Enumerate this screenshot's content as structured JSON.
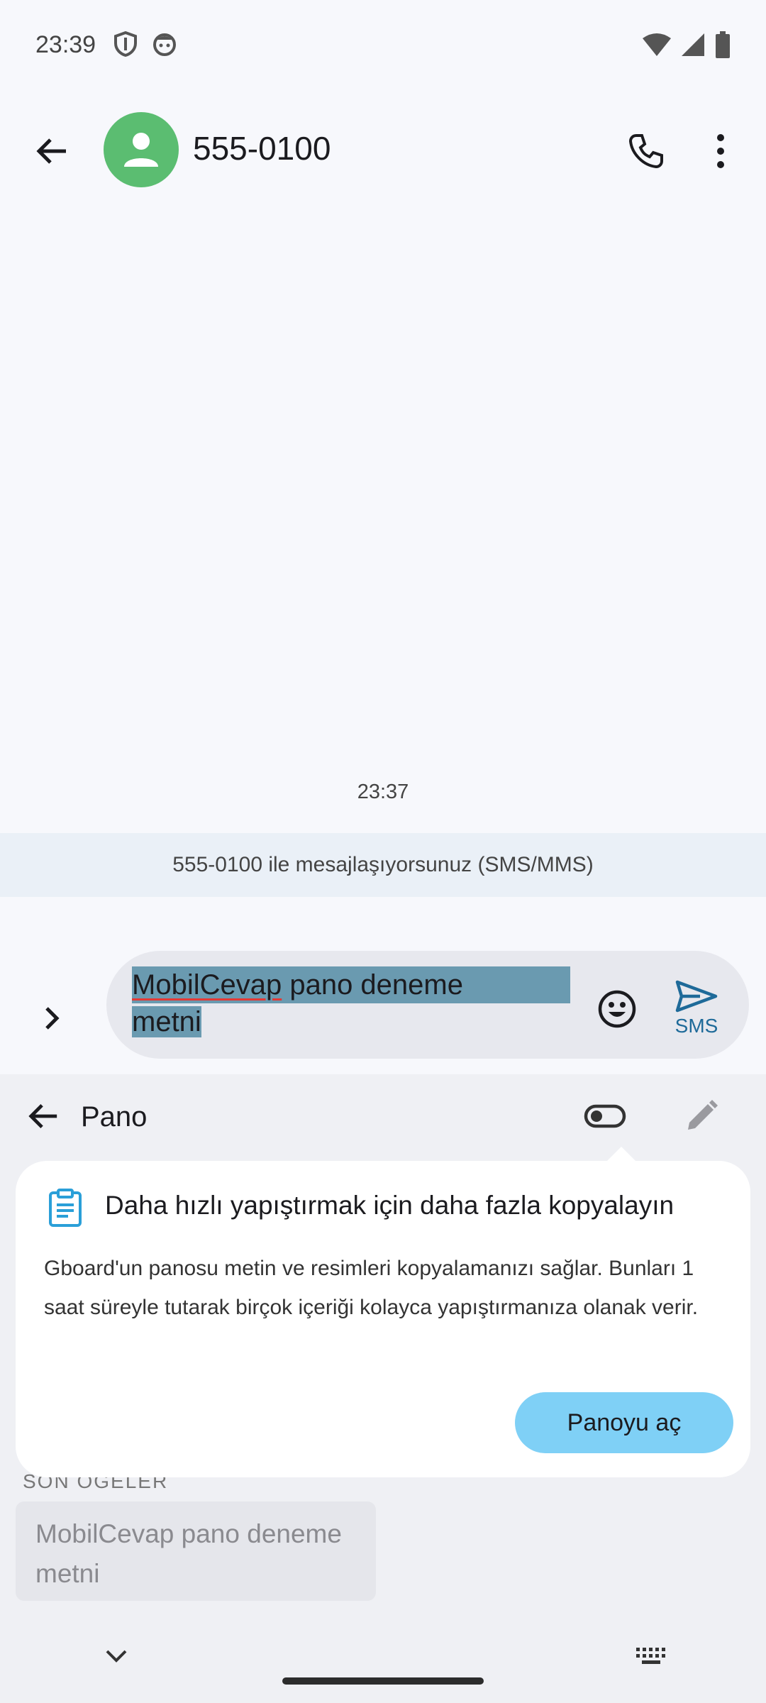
{
  "status_bar": {
    "time": "23:39",
    "left_icons": [
      "shield-icon",
      "face-icon"
    ],
    "right_icons": [
      "wifi-icon",
      "signal-icon",
      "battery-icon"
    ]
  },
  "app_bar": {
    "contact_name": "555-0100",
    "avatar_color": "#5bbd71",
    "actions": [
      "call-icon",
      "more-vert-icon"
    ]
  },
  "conversation": {
    "timestamp": "23:37",
    "info_banner": "555-0100 ile mesajlaşıyorsunuz (SMS/MMS)"
  },
  "composer": {
    "text_line1_underlined": "MobilCevap",
    "text_line1_rest": " pano deneme",
    "text_line2": "metni",
    "send_label": "SMS",
    "accent_color": "#1e6a99"
  },
  "keyboard": {
    "panel_title": "Pano",
    "recent_section_label": "SON ÖĞELER",
    "recent_items": [
      "MobilCevap pano deneme metni"
    ],
    "tip": {
      "title": "Daha hızlı yapıştırmak için daha fazla kopyalayın",
      "body": "Gboard'un panosu metin ve resimleri kopyalamanızı sağlar. Bunları 1 saat süreyle tutarak birçok içeriği kolayca yapıştırmanıza olanak verir.",
      "button_label": "Panoyu aç",
      "button_color": "#7fd0f6"
    }
  }
}
